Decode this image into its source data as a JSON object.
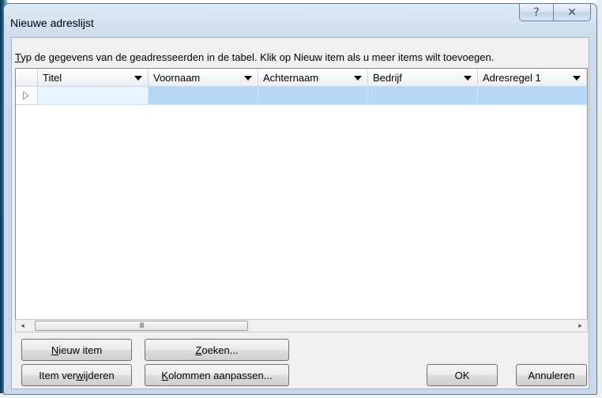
{
  "window": {
    "title": "Nieuwe adreslijst",
    "help_glyph": "?",
    "close_glyph": "✕"
  },
  "instruction": {
    "mnemonic": "T",
    "rest": "yp de gegevens van de geadresseerden in de tabel. Klik op Nieuw item als u meer items wilt toevoegen."
  },
  "grid": {
    "columns": [
      "Titel",
      "Voornaam",
      "Achternaam",
      "Bedrijf",
      "Adresregel 1"
    ],
    "rows": [
      [
        "",
        "",
        "",
        "",
        ""
      ]
    ]
  },
  "scrollbar": {
    "left_glyph": "◂",
    "right_glyph": "▸",
    "thumb_grip": "III"
  },
  "buttons": {
    "new_item": {
      "pre": "",
      "key": "N",
      "post": "ieuw item"
    },
    "search": {
      "pre": "",
      "key": "Z",
      "post": "oeken..."
    },
    "delete_item": {
      "pre": "Item ver",
      "key": "w",
      "post": "ijderen"
    },
    "customize_columns": {
      "pre": "",
      "key": "K",
      "post": "olommen aanpassen..."
    },
    "ok": "OK",
    "cancel": "Annuleren"
  },
  "colors": {
    "selection": "#b7d7f7",
    "title_bar": "#cddcec"
  }
}
